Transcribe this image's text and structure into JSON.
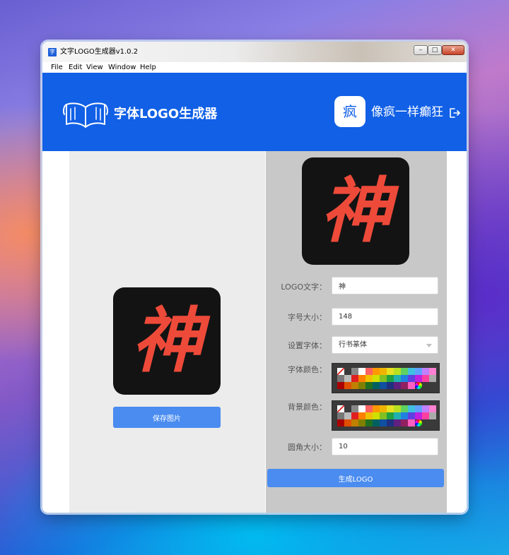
{
  "window": {
    "title": "文字LOGO生成器v1.0.2",
    "app_icon_glyph": "字",
    "controls": {
      "minimize": "–",
      "maximize": "□",
      "close": "✕"
    }
  },
  "menu": [
    "File",
    "Edit",
    "View",
    "Window",
    "Help"
  ],
  "header": {
    "app_name": "字体LOGO生成器",
    "logo_icon": "open-book-icon",
    "avatar_glyph": "疯",
    "username": "像疯一样癫狂",
    "logout_icon": "logout-icon",
    "colors": {
      "header_bg": "#1160e6",
      "accent": "#4a8cf0"
    }
  },
  "preview": {
    "glyph": "神",
    "glyph_color": "#ee4a3a",
    "bg_color": "#131313",
    "save_label": "保存图片"
  },
  "form": {
    "logo_text": {
      "label": "LOGO文字：",
      "value": "神"
    },
    "font_size": {
      "label": "字号大小：",
      "value": "148"
    },
    "font": {
      "label": "设置字体：",
      "value": "行书篆体"
    },
    "font_color": {
      "label": "字体颜色："
    },
    "bg_color": {
      "label": "背景颜色："
    },
    "radius": {
      "label": "圆角大小：",
      "value": "10"
    },
    "generate_label": "生成LOGO"
  },
  "palette": {
    "rows": [
      [
        "none",
        "#3a3a3a",
        "#888888",
        "#ffffff",
        "#ff6060",
        "#ff9800",
        "#f0b400",
        "#e8e020",
        "#b8e020",
        "#60d060",
        "#40c0e0",
        "#60a0ff",
        "#c080ff",
        "#ff80d0"
      ],
      [
        "#777777",
        "#bbbbbb",
        "#e02020",
        "#ff8000",
        "#f0c000",
        "#d0e000",
        "#80c020",
        "#20a040",
        "#20b0b0",
        "#2080e0",
        "#6040e0",
        "#c020e0",
        "#ff40a0",
        "#aaaaaa"
      ],
      [
        "#aa0000",
        "#e05000",
        "#c08000",
        "#808000",
        "#207020",
        "#006060",
        "#1050a0",
        "#203080",
        "#602080",
        "#902060",
        "#ff60c0",
        "spectrum"
      ]
    ]
  }
}
